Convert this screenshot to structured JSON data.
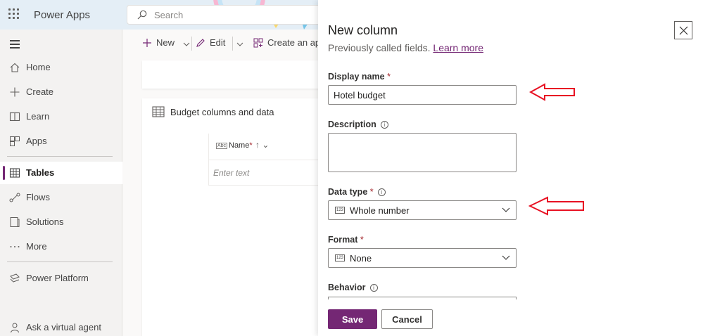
{
  "app": {
    "name": "Power Apps"
  },
  "search": {
    "placeholder": "Search"
  },
  "nav": {
    "items": [
      {
        "label": "Home",
        "icon": "home-icon"
      },
      {
        "label": "Create",
        "icon": "plus-icon"
      },
      {
        "label": "Learn",
        "icon": "book-icon"
      },
      {
        "label": "Apps",
        "icon": "apps-icon"
      },
      {
        "label": "Tables",
        "icon": "table-icon",
        "selected": true
      },
      {
        "label": "Flows",
        "icon": "flow-icon"
      },
      {
        "label": "Solutions",
        "icon": "solutions-icon"
      },
      {
        "label": "More",
        "icon": "more-icon"
      },
      {
        "label": "Power Platform",
        "icon": "power-platform-icon"
      },
      {
        "label": "Ask a virtual agent",
        "icon": "agent-icon"
      }
    ]
  },
  "toolbar": {
    "new_label": "New",
    "edit_label": "Edit",
    "create_app_label": "Create an app"
  },
  "table_card": {
    "title": "Budget columns and data",
    "column_header": "Name",
    "column_type_badge": "Abc",
    "cell_placeholder": "Enter text"
  },
  "panel": {
    "title": "New column",
    "subtitle": "Previously called fields.",
    "learn_more": "Learn more",
    "display_name_label": "Display name",
    "display_name_value": "Hotel budget",
    "description_label": "Description",
    "description_value": "",
    "data_type_label": "Data type",
    "data_type_value": "Whole number",
    "data_type_badge": "123",
    "format_label": "Format",
    "format_value": "None",
    "format_badge": "123",
    "behavior_label": "Behavior",
    "required_mark": "*",
    "save_label": "Save",
    "cancel_label": "Cancel"
  },
  "colors": {
    "accent": "#742774",
    "annotation": "#e81123",
    "header_bg": "#e4eef6"
  }
}
